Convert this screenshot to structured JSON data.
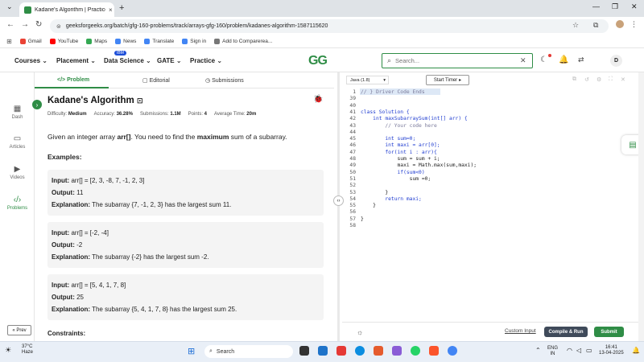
{
  "browser": {
    "tab_title": "Kadane's Algorithm | Practice |",
    "tab_close": "×",
    "new_tab": "+",
    "url": "geeksforgeeks.org/batch/gfg-160-problems/track/arrays-gfg-160/problem/kadanes-algorithm-1587115620",
    "window_controls": [
      "⌄",
      "—",
      "❐",
      "✕"
    ],
    "bookmarks": [
      {
        "label": "Gmail",
        "color": "#ea4335"
      },
      {
        "label": "YouTube",
        "color": "#ff0000"
      },
      {
        "label": "Maps",
        "color": "#34a853"
      },
      {
        "label": "News",
        "color": "#4285f4"
      },
      {
        "label": "Translate",
        "color": "#4285f4"
      },
      {
        "label": "Sign in",
        "color": "#4285f4"
      },
      {
        "label": "Add to Comparerea...",
        "color": "#777777"
      }
    ]
  },
  "site": {
    "menu": [
      "Courses",
      "Placement",
      "Data Science",
      "GATE",
      "Practice"
    ],
    "menu_badge": "IBM",
    "logo": "GG",
    "search_placeholder": "Search...",
    "avatar": "D",
    "accent": "#2f8d46"
  },
  "rail": {
    "items": [
      {
        "label": "Dash",
        "icon": "dashboard-icon"
      },
      {
        "label": "Articles",
        "icon": "articles-icon"
      },
      {
        "label": "Videos",
        "icon": "videos-icon"
      },
      {
        "label": "Problems",
        "icon": "code-icon"
      }
    ],
    "prev": "« Prev"
  },
  "problem": {
    "tabs": [
      "</> Problem",
      "Editorial",
      "Submissions"
    ],
    "title": "Kadane's Algorithm",
    "meta": {
      "difficulty_label": "Difficulty:",
      "difficulty": "Medium",
      "accuracy_label": "Accuracy:",
      "accuracy": "36.28%",
      "submissions_label": "Submissions:",
      "submissions": "1.1M",
      "points_label": "Points:",
      "points": "4",
      "time_label": "Average Time:",
      "time": "20m"
    },
    "description": {
      "pre": "Given an integer array ",
      "arr": "arr[]",
      "mid": ". You need to find the ",
      "max": "maximum",
      "post": " sum of a subarray."
    },
    "examples_heading": "Examples:",
    "examples": [
      {
        "input": "arr[] = [2, 3, -8, 7, -1, 2, 3]",
        "output": "11",
        "explanation": "The subarray {7, -1, 2, 3} has the largest sum 11."
      },
      {
        "input": "arr[] = [-2, -4]",
        "output": "-2",
        "explanation": "The subarray {-2} has the largest sum -2."
      },
      {
        "input": "arr[] = [5, 4, 1, 7, 8]",
        "output": "25",
        "explanation": "The subarray {5, 4, 1, 7, 8} has the largest sum 25."
      }
    ],
    "labels": {
      "input": "Input:",
      "output": "Output:",
      "explanation": "Explanation:"
    },
    "constraints_heading": "Constraints:"
  },
  "editor": {
    "language": "Java (1.8)",
    "timer": "Start Timer",
    "lines": [
      {
        "n": "1",
        "t": "// } Driver Code Ends"
      },
      {
        "n": "39",
        "t": ""
      },
      {
        "n": "40",
        "t": ""
      },
      {
        "n": "41",
        "t": "class Solution {"
      },
      {
        "n": "42",
        "t": "    int maxSubarraySum(int[] arr) {"
      },
      {
        "n": "43",
        "t": "        // Your code here"
      },
      {
        "n": "44",
        "t": ""
      },
      {
        "n": "45",
        "t": "        int sum=0;"
      },
      {
        "n": "46",
        "t": "        int maxi = arr[0];"
      },
      {
        "n": "47",
        "t": "        for(int i : arr){"
      },
      {
        "n": "48",
        "t": "            sum = sum + i;"
      },
      {
        "n": "49",
        "t": "            maxi = Math.max(sum,maxi);"
      },
      {
        "n": "50",
        "t": "            if(sum<0)"
      },
      {
        "n": "51",
        "t": "                sum =0;"
      },
      {
        "n": "52",
        "t": ""
      },
      {
        "n": "53",
        "t": "        }"
      },
      {
        "n": "54",
        "t": "        return maxi;"
      },
      {
        "n": "55",
        "t": "    }"
      },
      {
        "n": "56",
        "t": ""
      },
      {
        "n": "57",
        "t": "}"
      },
      {
        "n": "58",
        "t": ""
      }
    ],
    "custom_input": "Custom Input",
    "compile": "Compile & Run",
    "submit": "Submit"
  },
  "taskbar": {
    "temp": "37°C",
    "weather": "Haze",
    "search": "Search",
    "lang": "ENG",
    "region": "IN",
    "time": "16:41",
    "date": "13-04-2025"
  }
}
